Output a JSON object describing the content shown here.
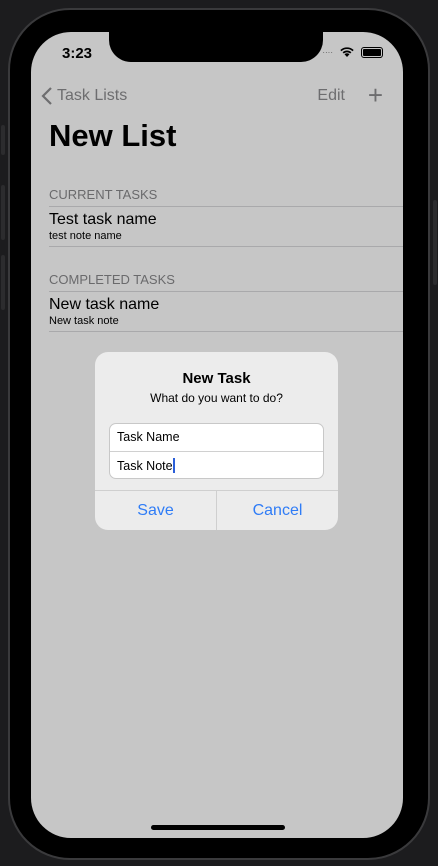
{
  "status_bar": {
    "time": "3:23"
  },
  "nav": {
    "back_label": "Task Lists",
    "edit_label": "Edit",
    "add_icon": "plus-icon"
  },
  "page": {
    "title": "New List"
  },
  "sections": [
    {
      "header": "CURRENT TASKS",
      "items": [
        {
          "name": "Test task name",
          "note": "test note name"
        }
      ]
    },
    {
      "header": "COMPLETED TASKS",
      "items": [
        {
          "name": "New task name",
          "note": "New task note"
        }
      ]
    }
  ],
  "alert": {
    "title": "New Task",
    "message": "What do you want to do?",
    "name_value": "Task Name",
    "note_value": "Task Note",
    "save_label": "Save",
    "cancel_label": "Cancel"
  },
  "colors": {
    "accent": "#2f7cf6",
    "dimmed_bg": "#c6c6c6"
  }
}
